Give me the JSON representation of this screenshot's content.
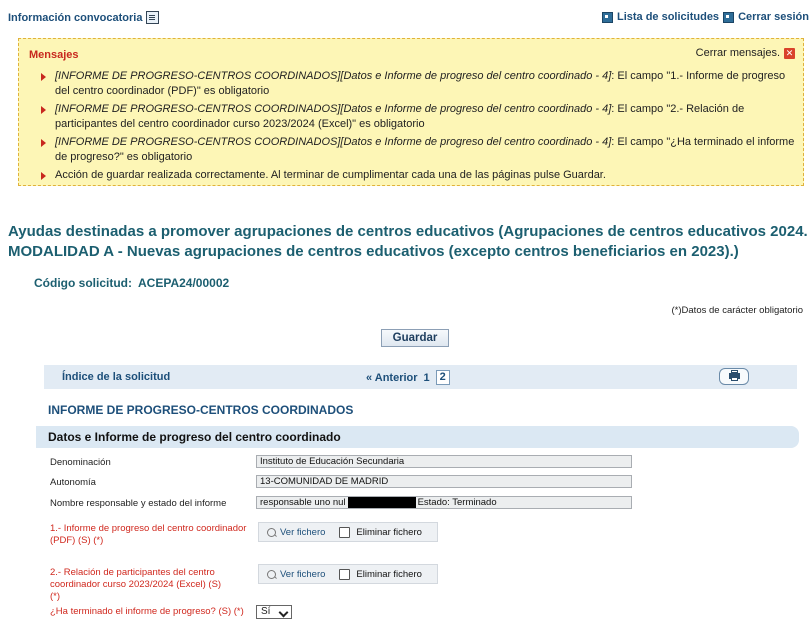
{
  "topbar": {
    "info_link": "Información convocatoria",
    "list_link": "Lista de solicitudes",
    "logout_link": "Cerrar sesión"
  },
  "messages": {
    "title": "Mensajes",
    "close_label": "Cerrar mensajes.",
    "items": [
      {
        "prefix": "[INFORME DE PROGRESO-CENTROS COORDINADOS][Datos e Informe de progreso del centro coordinado - 4]",
        "text": ": El campo \"1.- Informe de progreso del centro coordinador (PDF)\" es obligatorio"
      },
      {
        "prefix": "[INFORME DE PROGRESO-CENTROS COORDINADOS][Datos e Informe de progreso del centro coordinado - 4]",
        "text": ": El campo \"2.- Relación de participantes del centro coordinador curso 2023/2024 (Excel)\" es obligatorio"
      },
      {
        "prefix": "[INFORME DE PROGRESO-CENTROS COORDINADOS][Datos e Informe de progreso del centro coordinado - 4]",
        "text": ": El campo \"¿Ha terminado el informe de progreso?\" es obligatorio"
      },
      {
        "prefix": "",
        "text": "Acción de guardar realizada correctamente. Al terminar de cumplimentar cada una de las páginas pulse Guardar."
      }
    ]
  },
  "heading": "Ayudas destinadas a promover agrupaciones de centros educativos (Agrupaciones de centros educativos 2024. MODALIDAD A - Nuevas agrupaciones de centros educativos (excepto centros beneficiarios en 2023).)",
  "codigo": {
    "label": "Código solicitud:",
    "value": "ACEPA24/00002"
  },
  "required_note": "(*)Datos de carácter obligatorio",
  "save_label": "Guardar",
  "index_bar": {
    "label": "Índice de la solicitud",
    "prev": "« Anterior",
    "page1": "1",
    "page2": "2"
  },
  "section_title": "INFORME DE PROGRESO-CENTROS COORDINADOS",
  "subsection_title": "Datos e Informe de progreso del centro coordinado",
  "fields": {
    "denominacion_label": "Denominación",
    "denominacion_value": "Instituto de Educación Secundaria",
    "autonomia_label": "Autonomía",
    "autonomia_value": "13-COMUNIDAD DE MADRID",
    "responsable_label": "Nombre responsable y estado del informe",
    "responsable_value": "responsable uno nul",
    "estado_value": "Estado:  Terminado",
    "informe_label": "1.- Informe de progreso del centro coordinador (PDF) (S) (*)",
    "relacion_label": "2.- Relación de participantes del centro coordinador curso 2023/2024 (Excel) (S) (*)",
    "terminado_label": "¿Ha terminado el informe de progreso? (S) (*)",
    "terminado_value": "Sí"
  },
  "file": {
    "view_label": "Ver fichero",
    "delete_label": "Eliminar fichero"
  }
}
